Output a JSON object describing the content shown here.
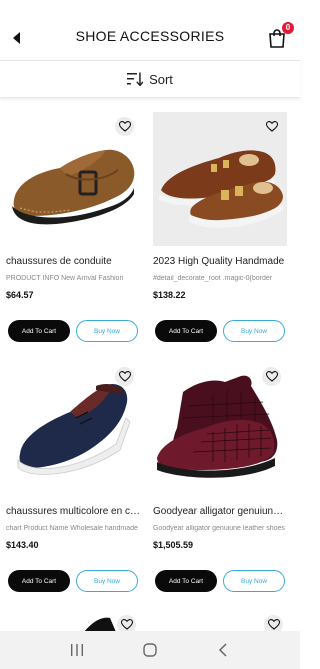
{
  "header": {
    "title": "SHOE ACCESSORIES",
    "cart_count": "0"
  },
  "sort": {
    "label": "Sort"
  },
  "products": [
    {
      "name": "chaussures de conduite",
      "desc": "PRODUCT INFO New Arrival Fashion",
      "price": "$64.57",
      "add_label": "Add To Cart",
      "buy_label": "Buy Now"
    },
    {
      "name": "2023 High Quality Handmade",
      "desc": "#detail_decorate_root .magic-0{border",
      "price": "$138.22",
      "add_label": "Add To Cart",
      "buy_label": "Buy Now"
    },
    {
      "name": "chaussures multicolore en cuir",
      "desc": "chart Product Name Wholesale handmade",
      "price": "$143.40",
      "add_label": "Add To Cart",
      "buy_label": "Buy Now"
    },
    {
      "name": "Goodyear alligator  genuiune leather",
      "desc": "Goodyear alligator genuiune leather shoes",
      "price": "$1,505.59",
      "add_label": "Add To Cart",
      "buy_label": "Buy Now"
    }
  ],
  "colors": {
    "accent": "#39a9dc",
    "badge": "#e21a3a",
    "button_dark": "#0a0a0a"
  }
}
